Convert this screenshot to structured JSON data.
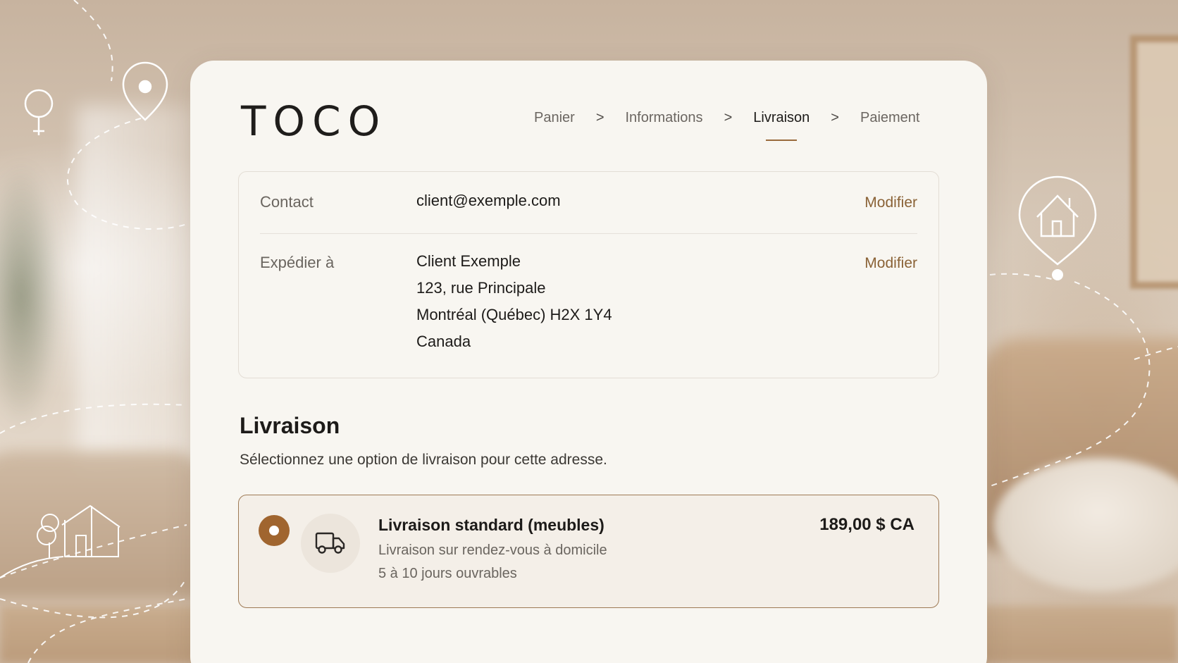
{
  "brand": {
    "logo": "TOCO"
  },
  "breadcrumb": {
    "steps": [
      "Panier",
      "Informations",
      "Livraison",
      "Paiement"
    ],
    "active_index": 2,
    "separator": ">"
  },
  "summary": {
    "contact": {
      "label": "Contact",
      "value": "client@exemple.com",
      "action": "Modifier"
    },
    "ship_to": {
      "label": "Expédier à",
      "lines": [
        "Client Exemple",
        "123, rue Principale",
        "Montréal (Québec) H2X 1Y4",
        "Canada"
      ],
      "action": "Modifier"
    }
  },
  "shipping": {
    "title": "Livraison",
    "subtitle": "Sélectionnez une option de livraison pour cette adresse.",
    "options": [
      {
        "name": "Livraison standard (meubles)",
        "detail": "Livraison sur rendez-vous à domicile",
        "delay": "5 à 10 jours ouvrables",
        "price": "189,00 $ CA",
        "selected": true,
        "icon": "truck-icon"
      }
    ]
  },
  "colors": {
    "accent": "#9a6a3c",
    "radio": "#a0652f",
    "card_bg": "#f8f6f1",
    "link": "#8a6236"
  }
}
